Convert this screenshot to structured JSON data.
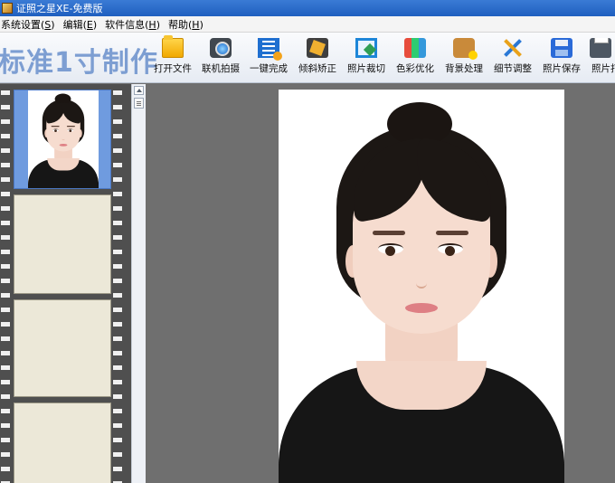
{
  "window": {
    "title": "证照之星XE-免费版"
  },
  "menu": {
    "items": [
      {
        "label": "系统设置(",
        "key": "S",
        "suffix": ")"
      },
      {
        "label": "编辑(",
        "key": "E",
        "suffix": ")"
      },
      {
        "label": "软件信息(",
        "key": "H",
        "suffix": ")"
      },
      {
        "label": "帮助(",
        "key": "H",
        "suffix": ")"
      }
    ]
  },
  "toolbar": {
    "mode_title": "标准1寸制作",
    "buttons": [
      {
        "label": "打开文件",
        "icon": "folder-icon"
      },
      {
        "label": "联机拍摄",
        "icon": "camera-icon"
      },
      {
        "label": "一键完成",
        "icon": "film-icon"
      },
      {
        "label": "倾斜矫正",
        "icon": "tilt-icon"
      },
      {
        "label": "照片裁切",
        "icon": "crop-icon"
      },
      {
        "label": "色彩优化",
        "icon": "color-icon"
      },
      {
        "label": "背景处理",
        "icon": "background-icon"
      },
      {
        "label": "细节调整",
        "icon": "tools-icon"
      },
      {
        "label": "照片保存",
        "icon": "save-icon"
      },
      {
        "label": "照片打",
        "icon": "print-icon"
      }
    ]
  },
  "colors": {
    "title_bar": "#1f5fbf",
    "mode_title": "#7d9ed2",
    "film_selected": "#6f9bdf",
    "film_empty": "#ece8d8",
    "canvas_bg": "#6f6f6f"
  }
}
